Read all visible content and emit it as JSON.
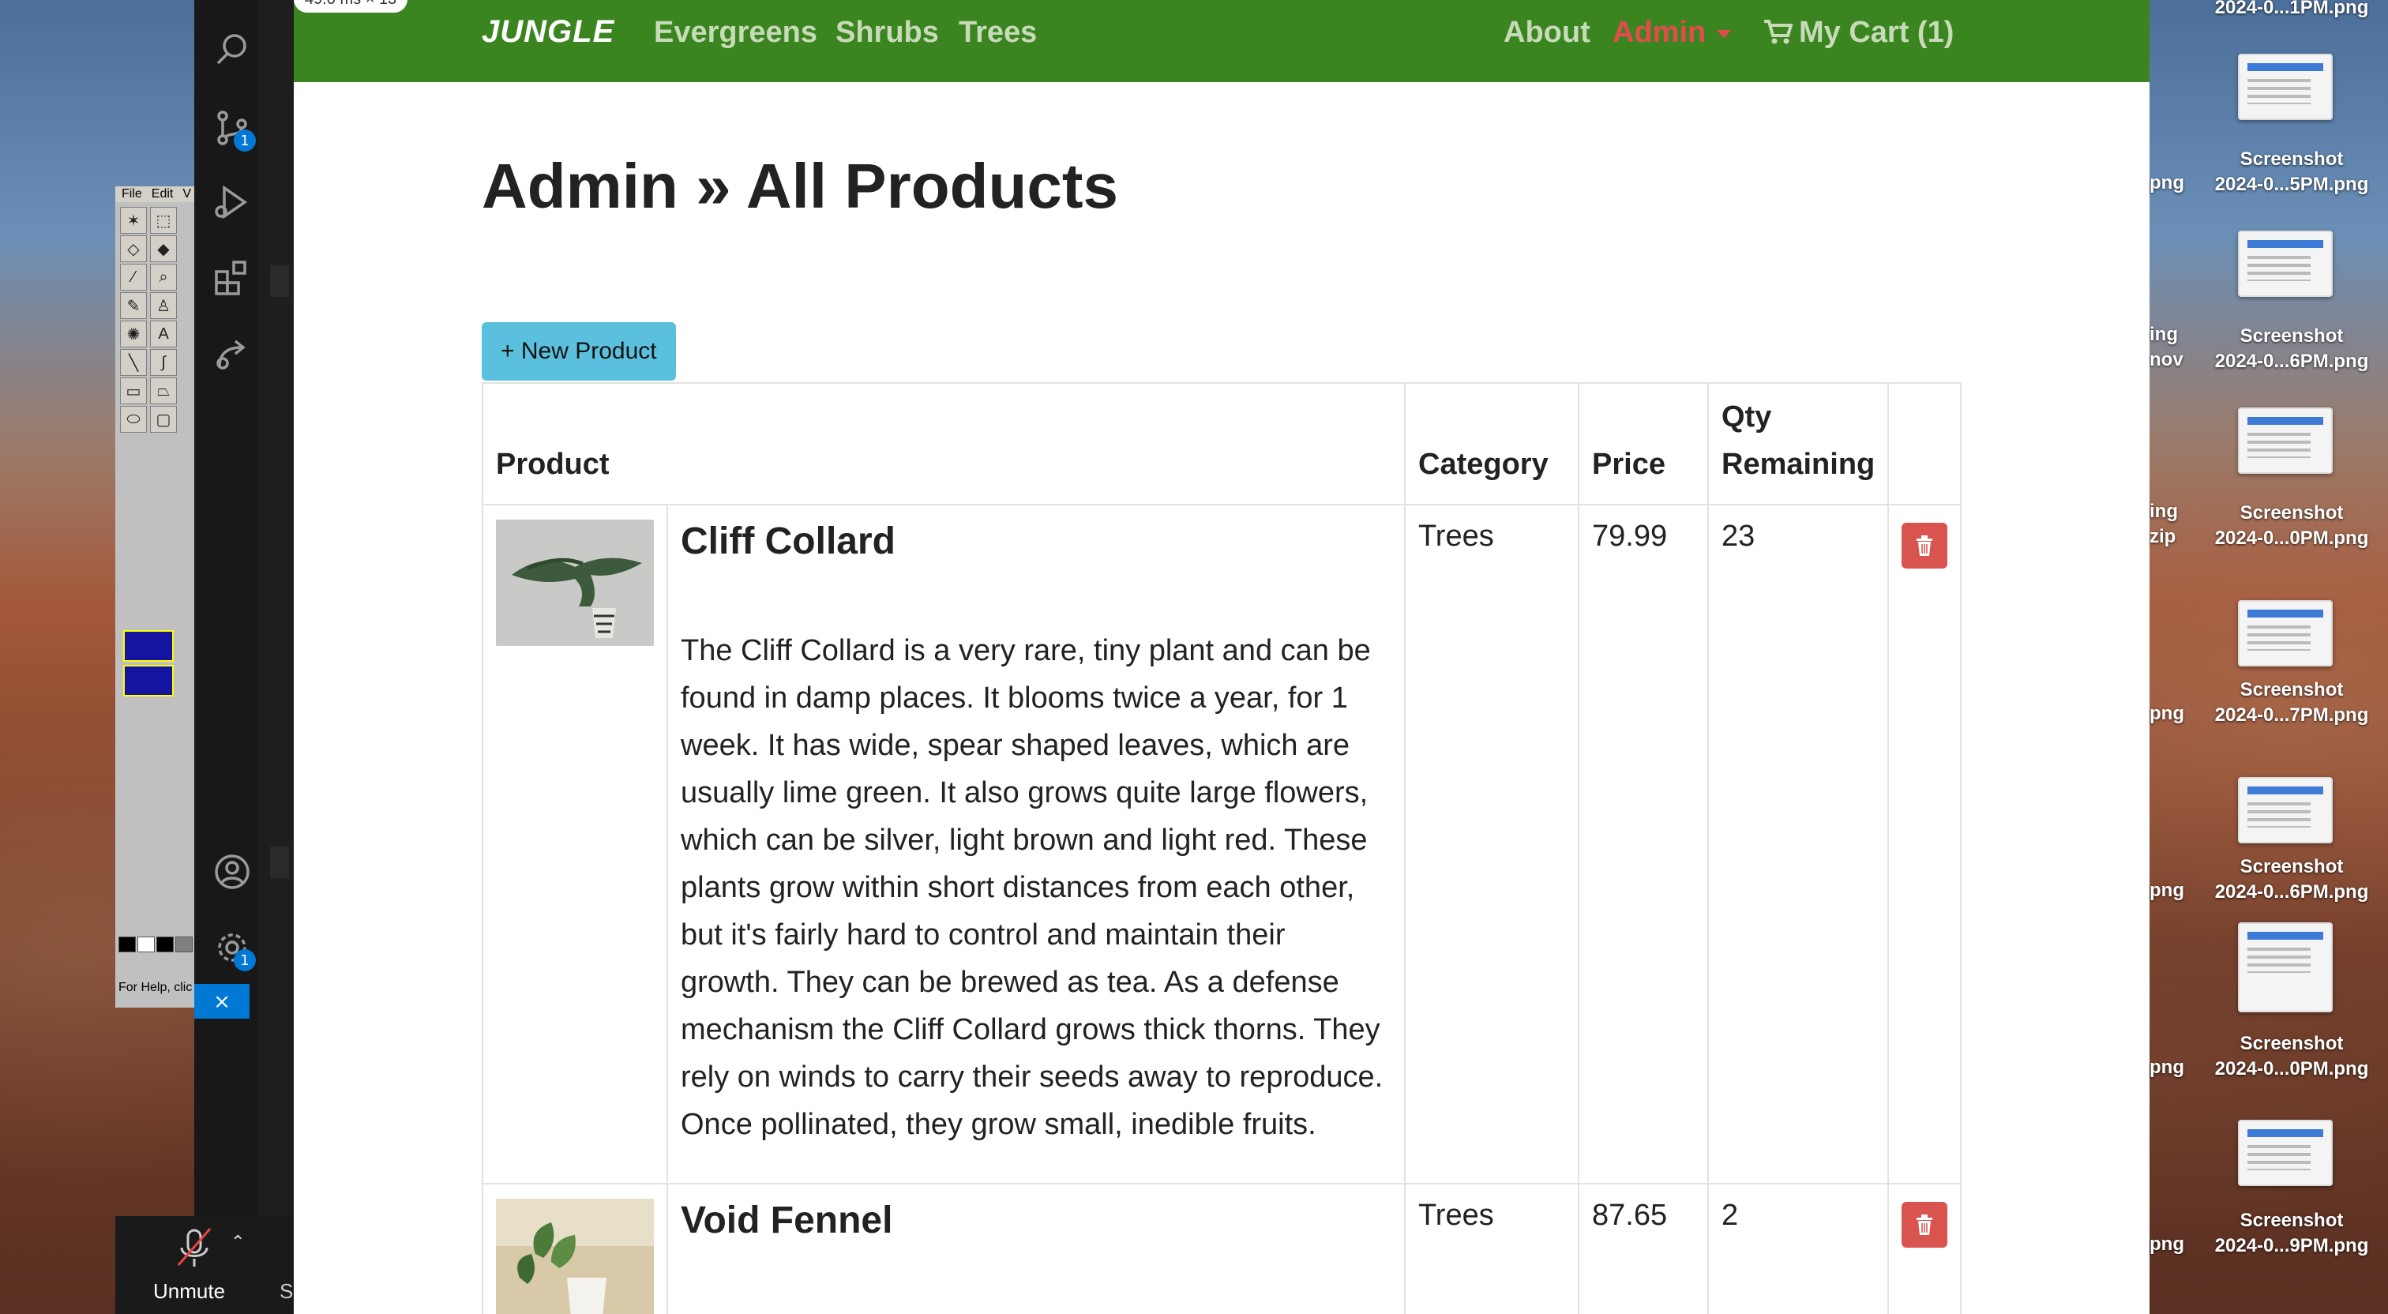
{
  "timer": "49.0 ms × 13",
  "paint": {
    "menu": [
      "File",
      "Edit",
      "V"
    ],
    "status": "For Help, clic"
  },
  "zoom": {
    "unmute_label": "Unmute",
    "side_letter": "S"
  },
  "vscode": {
    "scm_badge": "1",
    "settings_badge": "1"
  },
  "site": {
    "brand": "JUNGLE",
    "nav": {
      "evergreens": "Evergreens",
      "shrubs": "Shrubs",
      "trees": "Trees",
      "about": "About",
      "admin": "Admin",
      "cart": "My Cart (1)"
    },
    "heading": "Admin » All Products",
    "new_button": "+ New Product",
    "columns": {
      "product": "Product",
      "category": "Category",
      "price": "Price",
      "qty": "Qty Remaining"
    },
    "products": [
      {
        "name": "Cliff Collard",
        "description": "The Cliff Collard is a very rare, tiny plant and can be found in damp places. It blooms twice a year, for 1 week. It has wide, spear shaped leaves, which are usually lime green. It also grows quite large flowers, which can be silver, light brown and light red. These plants grow within short distances from each other, but it's fairly hard to control and maintain their growth. They can be brewed as tea. As a defense mechanism the Cliff Collard grows thick thorns. They rely on winds to carry their seeds away to reproduce. Once pollinated, they grow small, inedible fruits.",
        "category": "Trees",
        "price": "79.99",
        "qty": "23"
      },
      {
        "name": "Void Fennel",
        "description": "",
        "category": "Trees",
        "price": "87.65",
        "qty": "2"
      }
    ]
  },
  "desktop": {
    "top_label": "2024-0...1PM.png",
    "icons": [
      {
        "title": "Screenshot",
        "subtitle": "2024-0...5PM.png",
        "left": "png"
      },
      {
        "title": "Screenshot",
        "subtitle": "2024-0...6PM.png",
        "left": "ing",
        "left2": "nov"
      },
      {
        "title": "Screenshot",
        "subtitle": "2024-0...0PM.png",
        "left": "ing",
        "left2": "zip"
      },
      {
        "title": "Screenshot",
        "subtitle": "2024-0...7PM.png",
        "left": "png"
      },
      {
        "title": "Screenshot",
        "subtitle": "2024-0...6PM.png",
        "left": "png"
      },
      {
        "title": "Screenshot",
        "subtitle": "2024-0...0PM.png",
        "left": "png"
      },
      {
        "title": "Screenshot",
        "subtitle": "2024-0...9PM.png",
        "left": "png"
      }
    ]
  }
}
